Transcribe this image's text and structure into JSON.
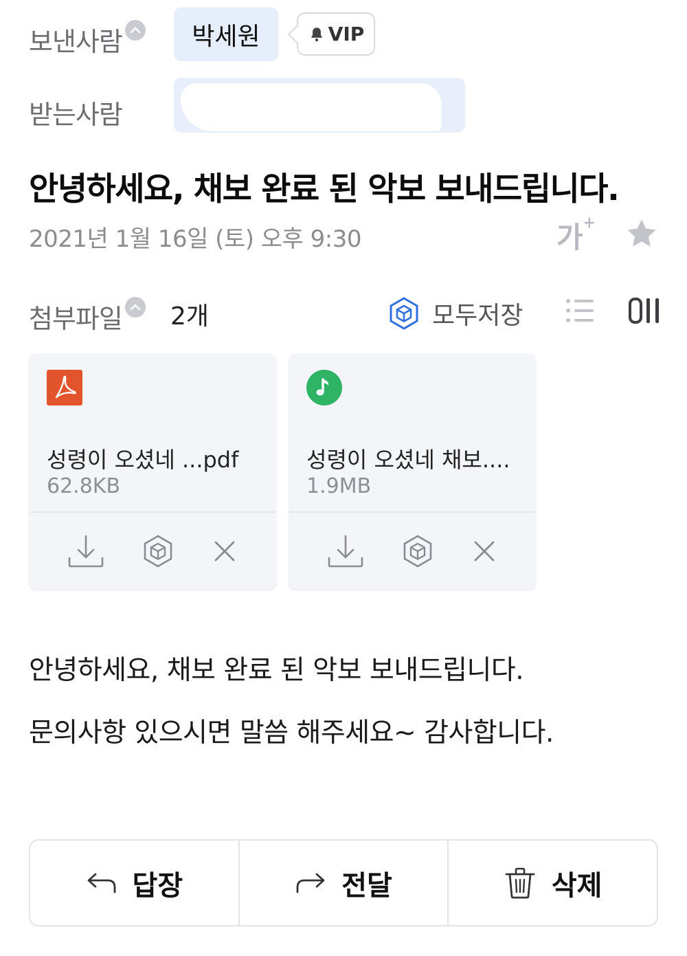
{
  "header": {
    "sender_label": "보낸사람",
    "sender_name": "박세원",
    "vip_badge": "VIP",
    "recipient_label": "받는사람"
  },
  "mail": {
    "subject": "안녕하세요, 채보 완료 된 악보 보내드립니다.",
    "date": "2021년 1월 16일 (토) 오후 9:30",
    "font_size_button": "가",
    "font_size_plus": "+"
  },
  "attachments": {
    "label": "첨부파일",
    "count": "2개",
    "save_all": "모두저장",
    "files": [
      {
        "name": "성령이 오셨네 ...pdf",
        "size": "62.8KB",
        "icon": "pdf-icon",
        "color": "#e2542c"
      },
      {
        "name": "성령이 오셨네 채보....",
        "size": "1.9MB",
        "icon": "music-note-icon",
        "color": "#2fb466"
      }
    ]
  },
  "body": {
    "line1": "안녕하세요, 채보 완료 된 악보 보내드립니다.",
    "line2": "문의사항 있으시면 말씀 해주세요~ 감사합니다."
  },
  "actions": {
    "reply": "답장",
    "forward": "전달",
    "delete": "삭제"
  },
  "colors": {
    "accent": "#2f6fde",
    "chip_bg": "#e6eefb",
    "muted": "#8c8c90"
  }
}
